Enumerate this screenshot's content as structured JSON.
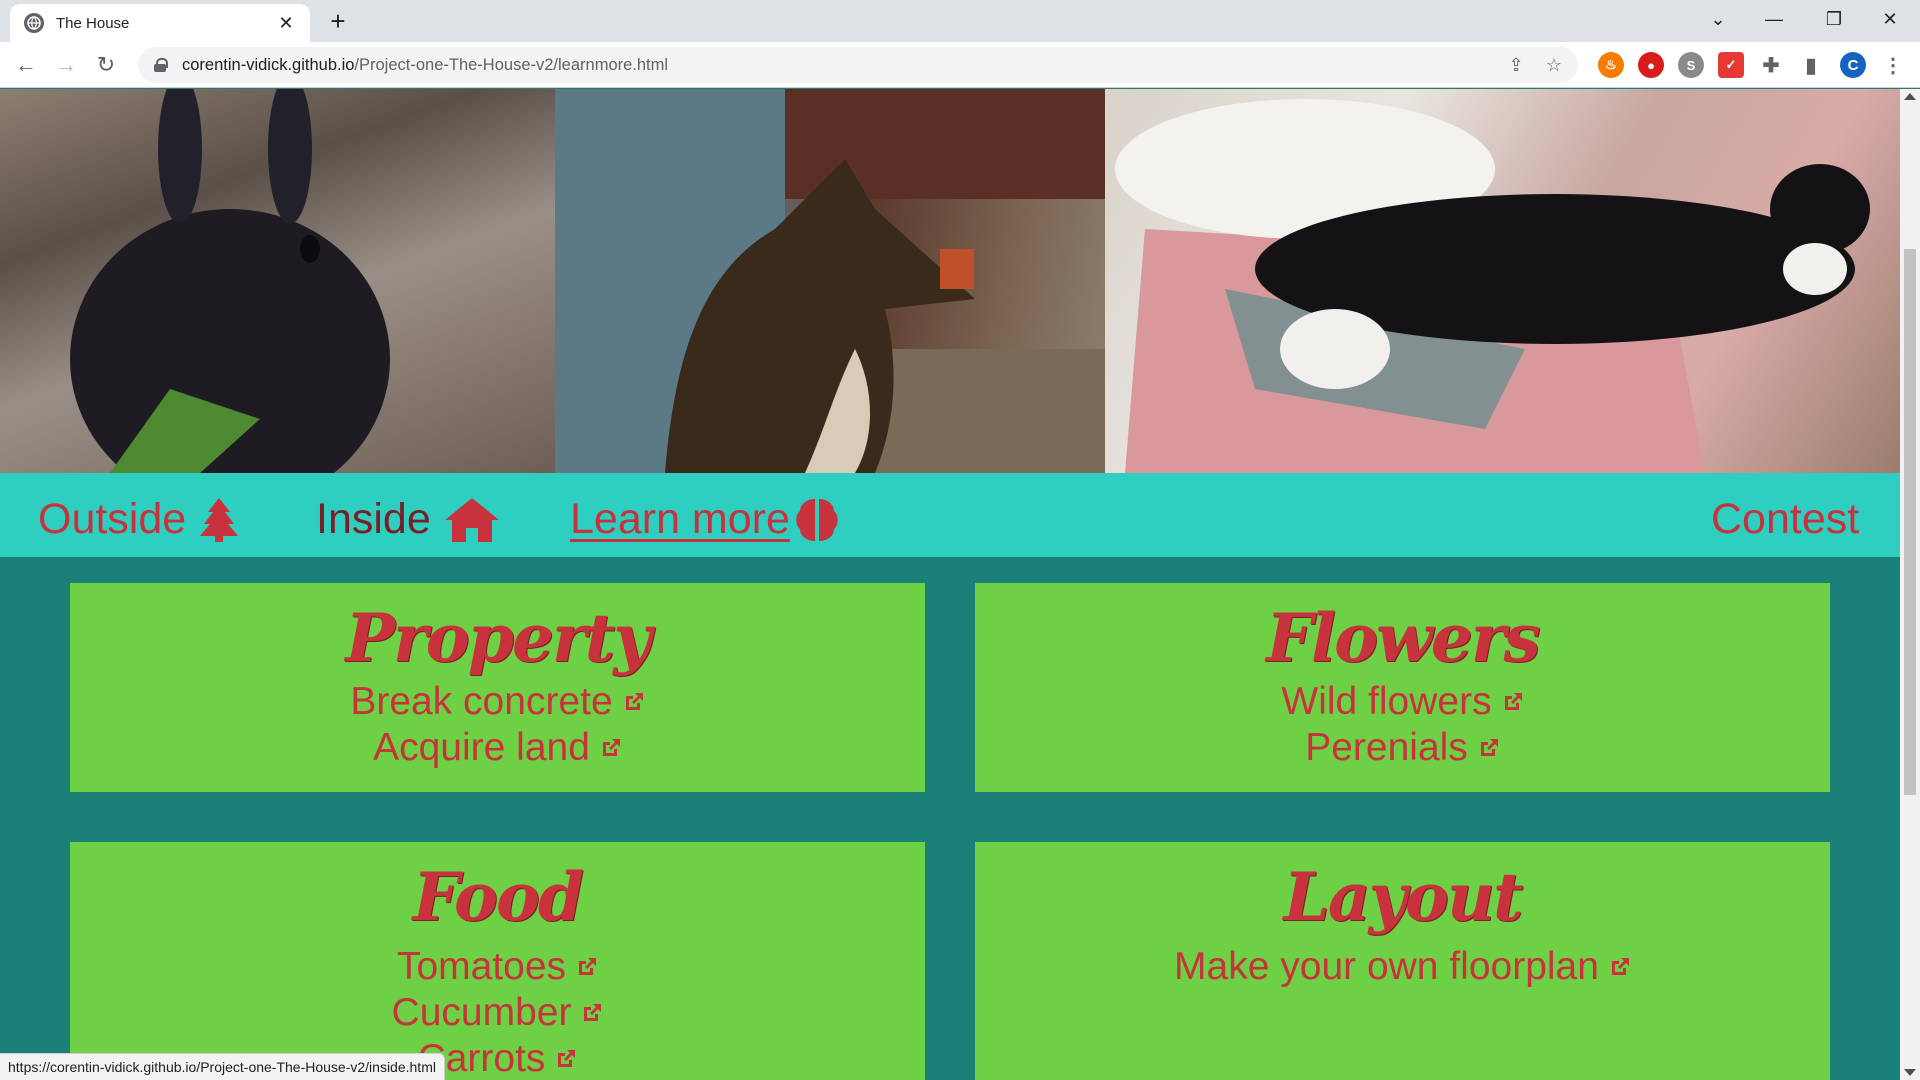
{
  "browser": {
    "tab_title": "The House",
    "url_host": "corentin-vidick.github.io",
    "url_path": "/Project-one-The-House-v2/learnmore.html",
    "profile_initial": "C",
    "status_url": "https://corentin-vidick.github.io/Project-one-The-House-v2/inside.html"
  },
  "nav": {
    "outside": "Outside",
    "inside": "Inside",
    "learn_more": "Learn more",
    "contest": "Contest"
  },
  "cards": {
    "property": {
      "title": "Property",
      "links": [
        "Break concrete",
        "Acquire land"
      ]
    },
    "flowers": {
      "title": "Flowers",
      "links": [
        "Wild flowers",
        "Perenials"
      ]
    },
    "food": {
      "title": "Food",
      "links": [
        "Tomatoes",
        "Cucumber",
        "Carrots"
      ]
    },
    "layout": {
      "title": "Layout",
      "links": [
        "Make your own floorplan"
      ]
    }
  },
  "colors": {
    "page_bg": "#1b8178",
    "navbar_bg": "#2ecfc1",
    "card_bg": "#6ed145",
    "accent_red": "#c8323c"
  },
  "icons": {
    "outside": "tree-icon",
    "inside": "house-icon",
    "learn_more": "brain-icon",
    "card_links": "external-link-icon"
  }
}
